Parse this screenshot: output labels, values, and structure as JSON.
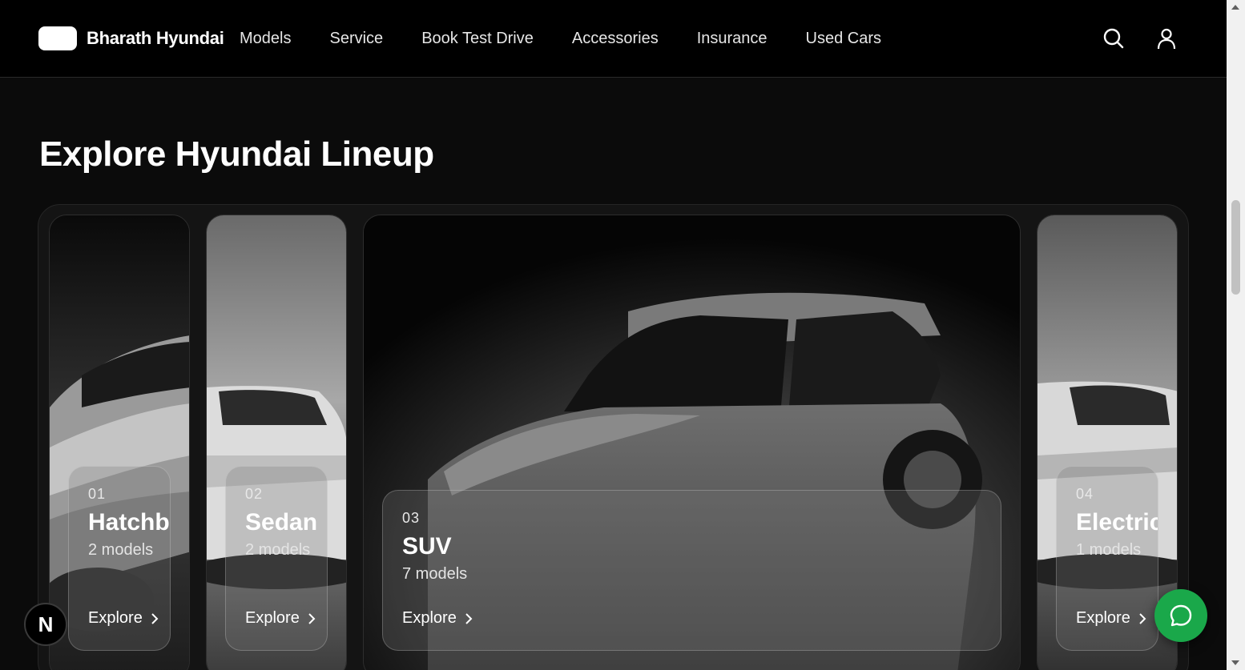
{
  "header": {
    "brand_name": "Bharath Hyundai",
    "nav": [
      "Models",
      "Service",
      "Book Test Drive",
      "Accessories",
      "Insurance",
      "Used Cars"
    ]
  },
  "section": {
    "title": "Explore Hyundai Lineup"
  },
  "cards": [
    {
      "num": "01",
      "title": "Hatchback",
      "count": "2 models",
      "explore": "Explore"
    },
    {
      "num": "02",
      "title": "Sedan",
      "count": "2 models",
      "explore": "Explore"
    },
    {
      "num": "03",
      "title": "SUV",
      "count": "7 models",
      "explore": "Explore"
    },
    {
      "num": "04",
      "title": "Electric",
      "count": "1 models",
      "explore": "Explore"
    }
  ],
  "fab": {
    "n_label": "N"
  },
  "colors": {
    "accent_chat": "#1aa84a",
    "header_bg": "#000000"
  },
  "icons": {
    "search": "search-icon",
    "user": "user-icon",
    "chat": "chat-icon",
    "chevron": "chevron-right-icon"
  }
}
